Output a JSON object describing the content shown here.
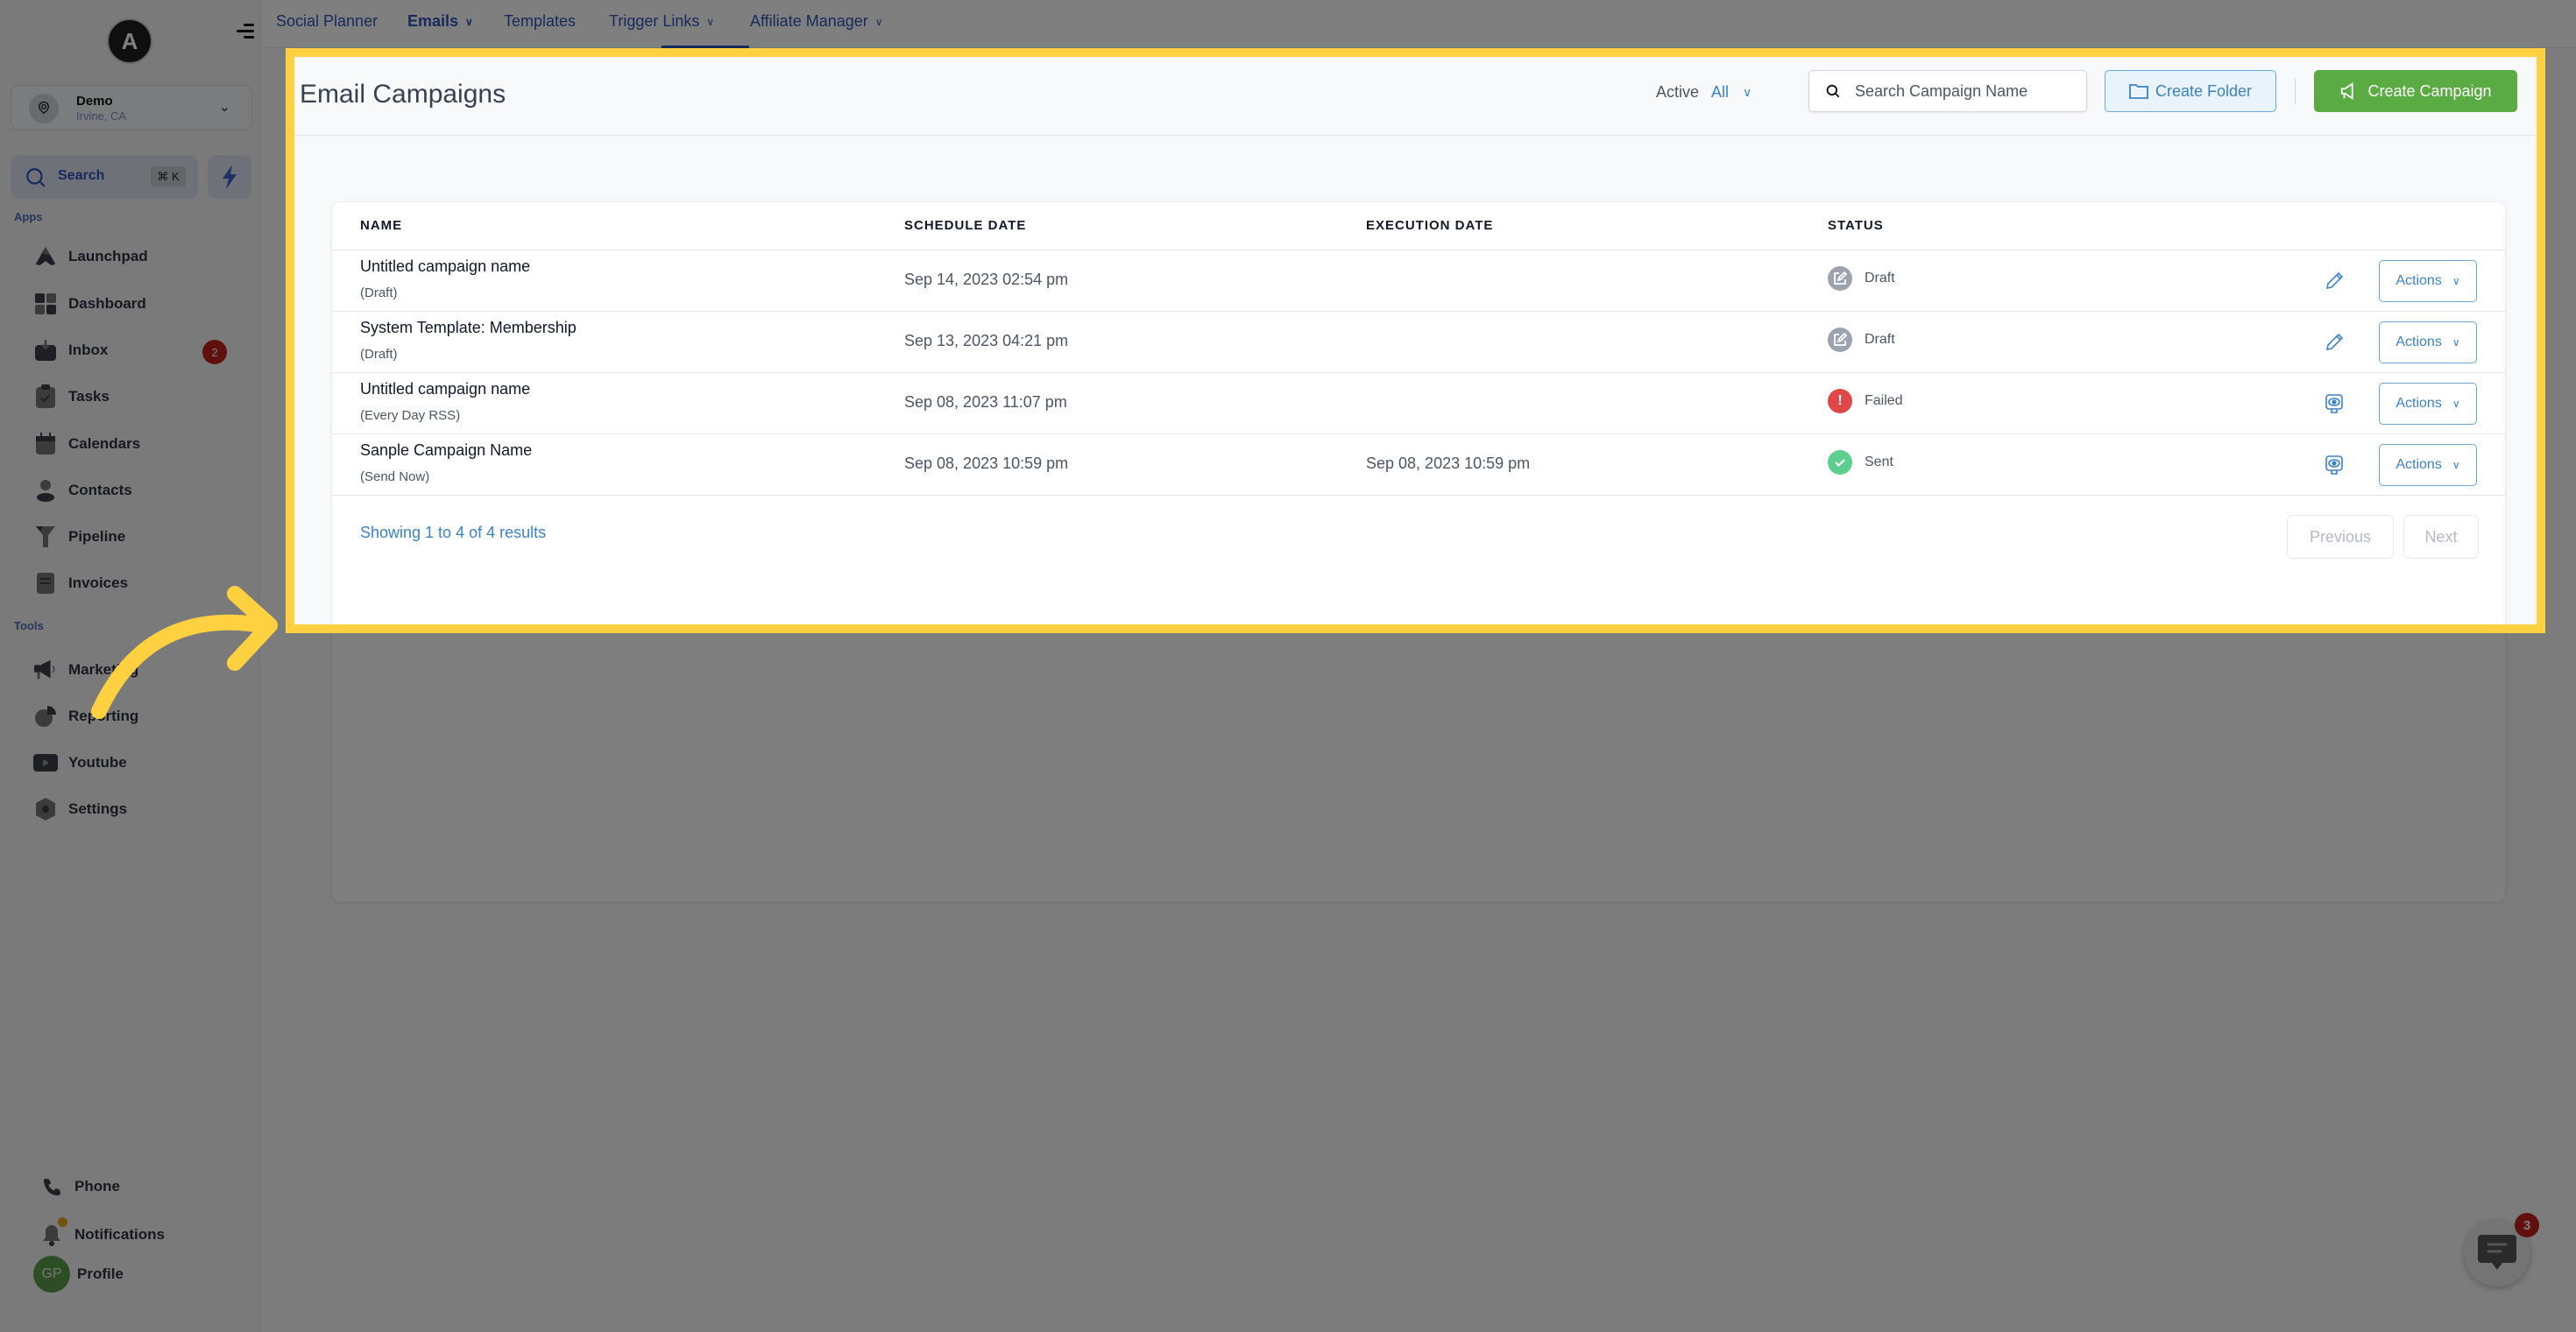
{
  "sidebar": {
    "logo_letter": "A",
    "location": {
      "name": "Demo",
      "city": "Irvine, CA"
    },
    "search": {
      "label": "Search",
      "shortcut": "⌘ K"
    },
    "apps_label": "Apps",
    "apps": [
      {
        "label": "Launchpad",
        "icon": "rocket-icon"
      },
      {
        "label": "Dashboard",
        "icon": "dashboard-grid-icon"
      },
      {
        "label": "Inbox",
        "icon": "inbox-icon",
        "badge": "2"
      },
      {
        "label": "Tasks",
        "icon": "clipboard-check-icon"
      },
      {
        "label": "Calendars",
        "icon": "calendar-icon"
      },
      {
        "label": "Contacts",
        "icon": "person-icon"
      },
      {
        "label": "Pipeline",
        "icon": "funnel-icon"
      },
      {
        "label": "Invoices",
        "icon": "receipt-icon"
      }
    ],
    "tools_label": "Tools",
    "tools": [
      {
        "label": "Marketing",
        "icon": "megaphone-icon"
      },
      {
        "label": "Reporting",
        "icon": "pie-chart-icon"
      },
      {
        "label": "Youtube",
        "icon": "youtube-icon"
      },
      {
        "label": "Settings",
        "icon": "settings-hex-icon"
      }
    ],
    "bottom": {
      "phone": "Phone",
      "notifications": "Notifications",
      "profile": "Profile",
      "profile_initials": "GP"
    }
  },
  "topnav": {
    "tabs": [
      {
        "label": "Social Planner",
        "dropdown": false,
        "active": false
      },
      {
        "label": "Emails",
        "dropdown": true,
        "active": true
      },
      {
        "label": "Templates",
        "dropdown": false,
        "active": false
      },
      {
        "label": "Trigger Links",
        "dropdown": true,
        "active": false
      },
      {
        "label": "Affiliate Manager",
        "dropdown": true,
        "active": false
      }
    ]
  },
  "header": {
    "title": "Email Campaigns",
    "filter_label": "Active",
    "filter_value": "All",
    "search_placeholder": "Search Campaign Name",
    "create_folder": "Create Folder",
    "create_campaign": "Create Campaign"
  },
  "table": {
    "columns": [
      "NAME",
      "SCHEDULE DATE",
      "EXECUTION DATE",
      "STATUS"
    ],
    "rows": [
      {
        "name": "Untitled campaign name",
        "type": "(Draft)",
        "schedule_date": "Sep 14, 2023 02:54 pm",
        "execution_date": "",
        "status": "Draft",
        "row_icon": "edit-pencil-icon",
        "actions": "Actions"
      },
      {
        "name": "System Template: Membership",
        "type": "(Draft)",
        "schedule_date": "Sep 13, 2023 04:21 pm",
        "execution_date": "",
        "status": "Draft",
        "row_icon": "edit-pencil-icon",
        "actions": "Actions"
      },
      {
        "name": "Untitled campaign name",
        "type": "(Every Day RSS)",
        "schedule_date": "Sep 08, 2023 11:07 pm",
        "execution_date": "",
        "status": "Failed",
        "row_icon": "preview-eye-icon",
        "actions": "Actions"
      },
      {
        "name": "Sanple Campaign Name",
        "type": "(Send Now)",
        "schedule_date": "Sep 08, 2023 10:59 pm",
        "execution_date": "Sep 08, 2023 10:59 pm",
        "status": "Sent",
        "row_icon": "preview-eye-icon",
        "actions": "Actions"
      }
    ],
    "footer": {
      "showing": "Showing 1 to 4 of 4 results",
      "previous": "Previous",
      "next": "Next"
    }
  },
  "status_colors": {
    "Draft": "#9ca3af",
    "Failed": "#e04848",
    "Sent": "#5ccf8f"
  },
  "colors": {
    "accent": "#3b82c4",
    "primary_green": "#5aab43",
    "highlight": "#ffd140",
    "nav_blue": "#2f55b5"
  },
  "chat_widget": {
    "count": "3"
  }
}
